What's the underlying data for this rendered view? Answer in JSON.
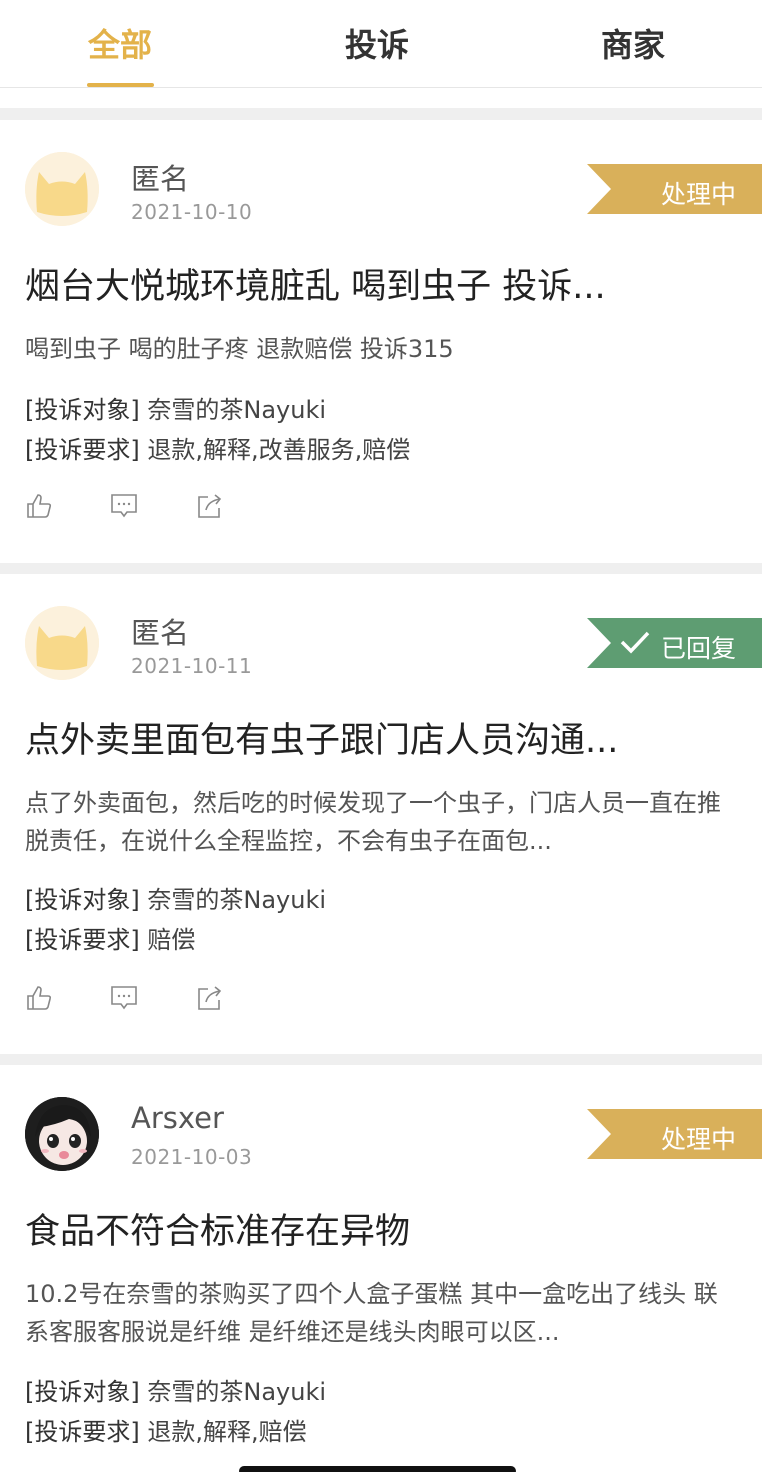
{
  "tabs": [
    {
      "label": "全部",
      "active": true
    },
    {
      "label": "投诉",
      "active": false
    },
    {
      "label": "商家",
      "active": false
    }
  ],
  "colors": {
    "accent": "#e3b24a",
    "processing": "#d9b05a",
    "replied": "#5e9d72"
  },
  "posts": [
    {
      "user": "匿名",
      "date": "2021-10-10",
      "avatar": "cat-avatar",
      "status": "处理中",
      "status_type": "processing",
      "title": "烟台大悦城环境脏乱 喝到虫子 投诉...",
      "desc": "喝到虫子 喝的肚子疼 退款赔偿 投诉315",
      "target_key": "[投诉对象]",
      "target": "奈雪的茶Nayuki",
      "demand_key": "[投诉要求]",
      "demand": "退款,解释,改善服务,赔偿"
    },
    {
      "user": "匿名",
      "date": "2021-10-11",
      "avatar": "cat-avatar",
      "status": "已回复",
      "status_type": "replied",
      "title": "点外卖里面包有虫子跟门店人员沟通...",
      "desc": "点了外卖面包，然后吃的时候发现了一个虫子，门店人员一直在推脱责任，在说什么全程监控，不会有虫子在面包...",
      "target_key": "[投诉对象]",
      "target": "奈雪的茶Nayuki",
      "demand_key": "[投诉要求]",
      "demand": "赔偿"
    },
    {
      "user": "Arsxer",
      "date": "2021-10-03",
      "avatar": "anime-girl-avatar",
      "status": "处理中",
      "status_type": "processing",
      "title": "食品不符合标准存在异物",
      "desc": "10.2号在奈雪的茶购买了四个人盒子蛋糕 其中一盒吃出了线头 联系客服客服说是纤维 是纤维还是线头肉眼可以区...",
      "target_key": "[投诉对象]",
      "target": "奈雪的茶Nayuki",
      "demand_key": "[投诉要求]",
      "demand": "退款,解释,赔偿"
    }
  ]
}
